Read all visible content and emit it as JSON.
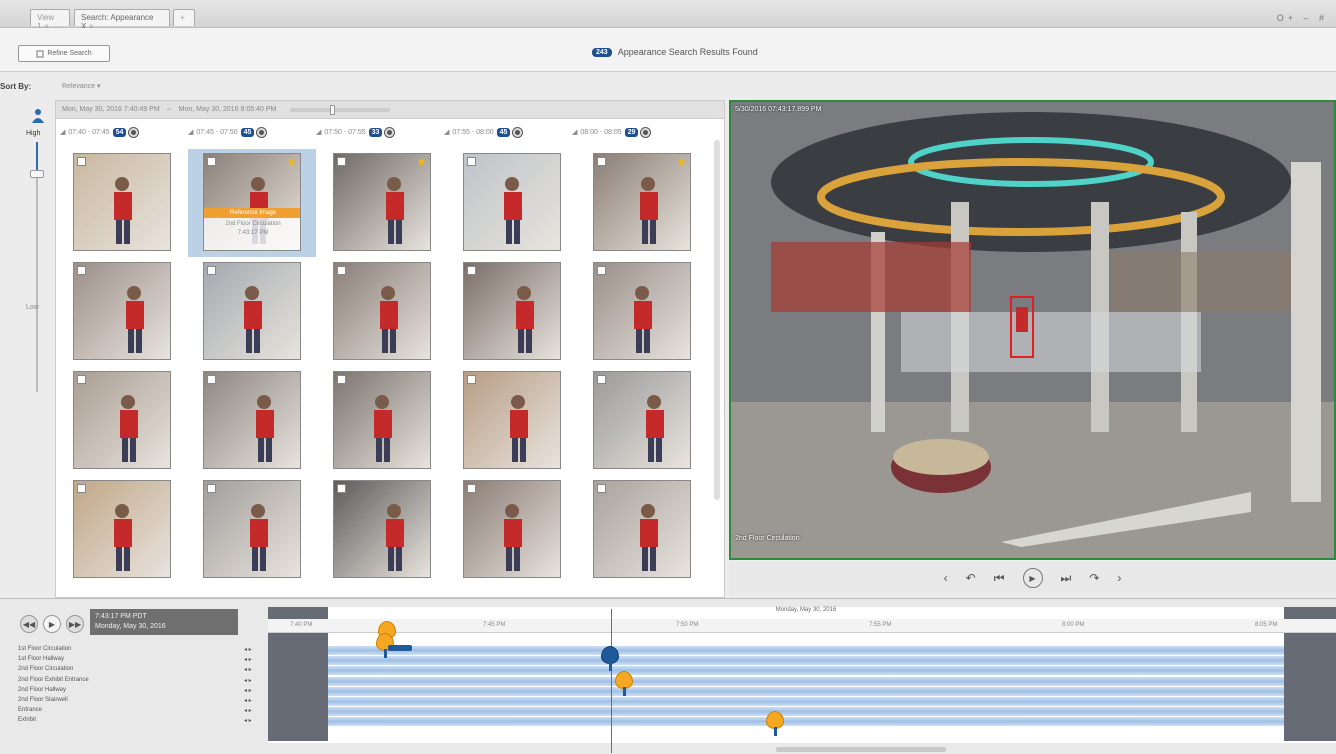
{
  "tabs": [
    {
      "label": "View 1",
      "close": "x"
    },
    {
      "label": "Search: Appearance X",
      "close": "x"
    },
    {
      "label": "+",
      "close": ""
    }
  ],
  "window_controls": "O+ – #",
  "toolbar": {
    "refine_label": "Refine Search",
    "results_count": "243",
    "results_label": "Appearance Search Results Found"
  },
  "sort": {
    "label": "Sort By:",
    "value": "Relevance"
  },
  "confidence": {
    "high_label": "High",
    "low_label": "Low",
    "level": 0.88
  },
  "date_range": {
    "start": "Mon, May 30, 2016 7:40:49 PM",
    "end": "Mon, May 30, 2016 8:05:40 PM"
  },
  "groups": [
    {
      "range": "07:40 - 07:45",
      "count": "54"
    },
    {
      "range": "07:45 - 07:50",
      "count": "45"
    },
    {
      "range": "07:50 - 07:55",
      "count": "33"
    },
    {
      "range": "07:55 - 08:00",
      "count": "45"
    },
    {
      "range": "08:00 - 08:05",
      "count": "29"
    }
  ],
  "selected_overlay": {
    "bar": "Reference Image",
    "camera": "2nd Floor Circulation",
    "time": "7:43:17 PM"
  },
  "thumb_colors": [
    "#c9b8a0",
    "#8a8077",
    "#6f6a66",
    "#bfc4c9",
    "#8a7e74",
    "#9c9089",
    "#a4aab0",
    "#8a7e78",
    "#7a6f68",
    "#9a8f89",
    "#a99d92",
    "#8d8780",
    "#7b7470",
    "#b79d85",
    "#9a9a9a",
    "#c0a788",
    "#a29e9c",
    "#5e5b5a",
    "#8b7d76",
    "#a8a29d"
  ],
  "video": {
    "timestamp": "5/30/2016 07:43:17.899 PM ",
    "camera": "2nd Floor Circulation"
  },
  "controls": [
    "‹",
    "↶",
    "⏮",
    "▶",
    "⏭",
    "↷",
    "›"
  ],
  "timeline": {
    "current_time": "7:43:17 PM PDT",
    "current_date": "Monday, May 30, 2016",
    "header_date": "Monday, May 30, 2016",
    "ticks": [
      "7:40 PM",
      "7:45 PM",
      "7:50 PM",
      "7:55 PM",
      "8:00 PM",
      "8:05 PM"
    ],
    "rows": [
      "1st Floor Circulation",
      "1st Floor Hallway",
      "2nd Floor Circulation",
      "2nd Floor Exhibit Entrance",
      "2nd Floor Hallway",
      "2nd Floor Stairwell",
      "Entrance",
      "Exhibit"
    ]
  }
}
